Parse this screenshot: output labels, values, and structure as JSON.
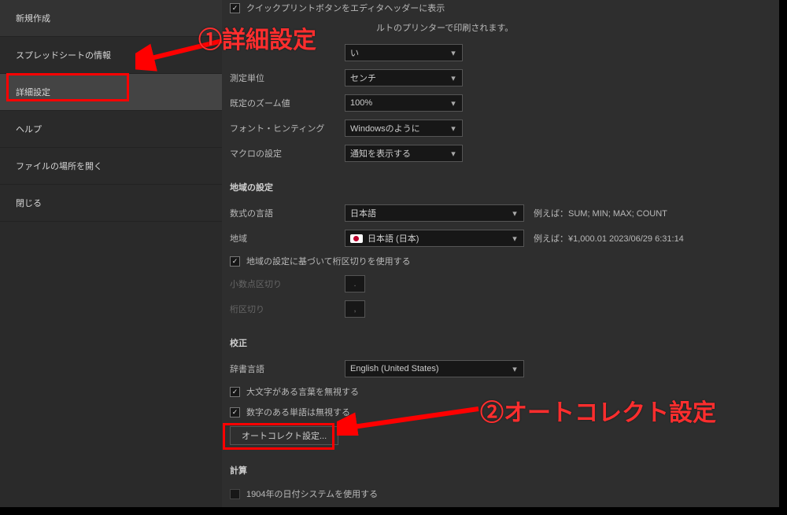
{
  "sidebar": {
    "items": [
      {
        "label": "新規作成"
      },
      {
        "label": "スプレッドシートの情報"
      },
      {
        "label": "詳細設定"
      },
      {
        "label": "ヘルプ"
      },
      {
        "label": "ファイルの場所を開く"
      },
      {
        "label": "閉じる"
      }
    ]
  },
  "top_check": {
    "label": "クイックプリントボタンをエディタヘッダーに表示"
  },
  "top_hint": "ルトのプリンターで印刷されます。",
  "half_dd": {
    "value": "い"
  },
  "rows": {
    "meas_unit": {
      "label": "測定単位",
      "value": "センチ"
    },
    "zoom": {
      "label": "既定のズーム値",
      "value": "100%"
    },
    "font_hint": {
      "label": "フォント・ヒンティング",
      "value": "Windowsのように"
    },
    "macro": {
      "label": "マクロの設定",
      "value": "通知を表示する"
    }
  },
  "section_region_title": "地域の設定",
  "region": {
    "formula_lang": {
      "label": "数式の言語",
      "value": "日本語",
      "hint": "例えば：SUM; MIN; MAX; COUNT"
    },
    "locale": {
      "label": "地域",
      "value": "日本語 (日本)",
      "hint": "例えば：¥1,000.01 2023/06/29 6:31:14"
    },
    "use_grouping_cb": "地域の設定に基づいて桁区切りを使用する",
    "decimal_sep": {
      "label": "小数点区切り",
      "value": "."
    },
    "group_sep": {
      "label": "桁区切り",
      "value": ","
    }
  },
  "section_proof_title": "校正",
  "proof": {
    "dict_lang": {
      "label": "辞書言語",
      "value": "English (United States)"
    },
    "ignore_upper_cb": "大文字がある言葉を無視する",
    "ignore_digits_cb": "数字のある単語は無視する",
    "autocorrect_btn": "オートコレクト設定..."
  },
  "section_calc_title": "計算",
  "calc": {
    "use_1904_cb": "1904年の日付システムを使用する"
  },
  "annot": {
    "one": "①詳細設定",
    "two": "②オートコレクト設定"
  },
  "colors": {
    "accent_red": "#ff0000"
  }
}
